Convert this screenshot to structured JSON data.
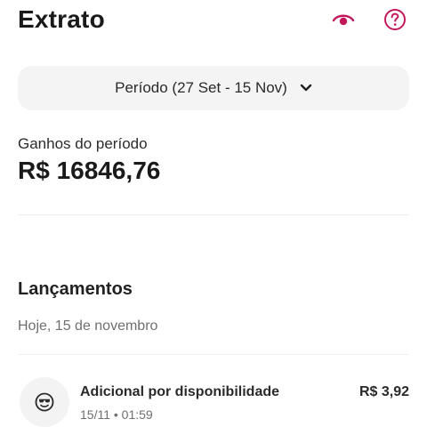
{
  "header": {
    "title": "Extrato",
    "eye_icon": "eye-icon",
    "help_icon": "question-circle-icon",
    "accent_color": "#c2185b"
  },
  "period": {
    "label": "Período (27 Set - 15 Nov)",
    "chevron_icon": "chevron-down-icon"
  },
  "earnings": {
    "label": "Ganhos do período",
    "value": "R$ 16846,76"
  },
  "entries_section": {
    "title": "Lançamentos",
    "date_label": "Hoje, 15 de novembro",
    "items": [
      {
        "title": "Adicional por disponibilidade",
        "subtitle": "15/11 • 01:59",
        "amount": "R$ 3,92",
        "icon": "smiley-sunglasses-icon"
      }
    ]
  }
}
